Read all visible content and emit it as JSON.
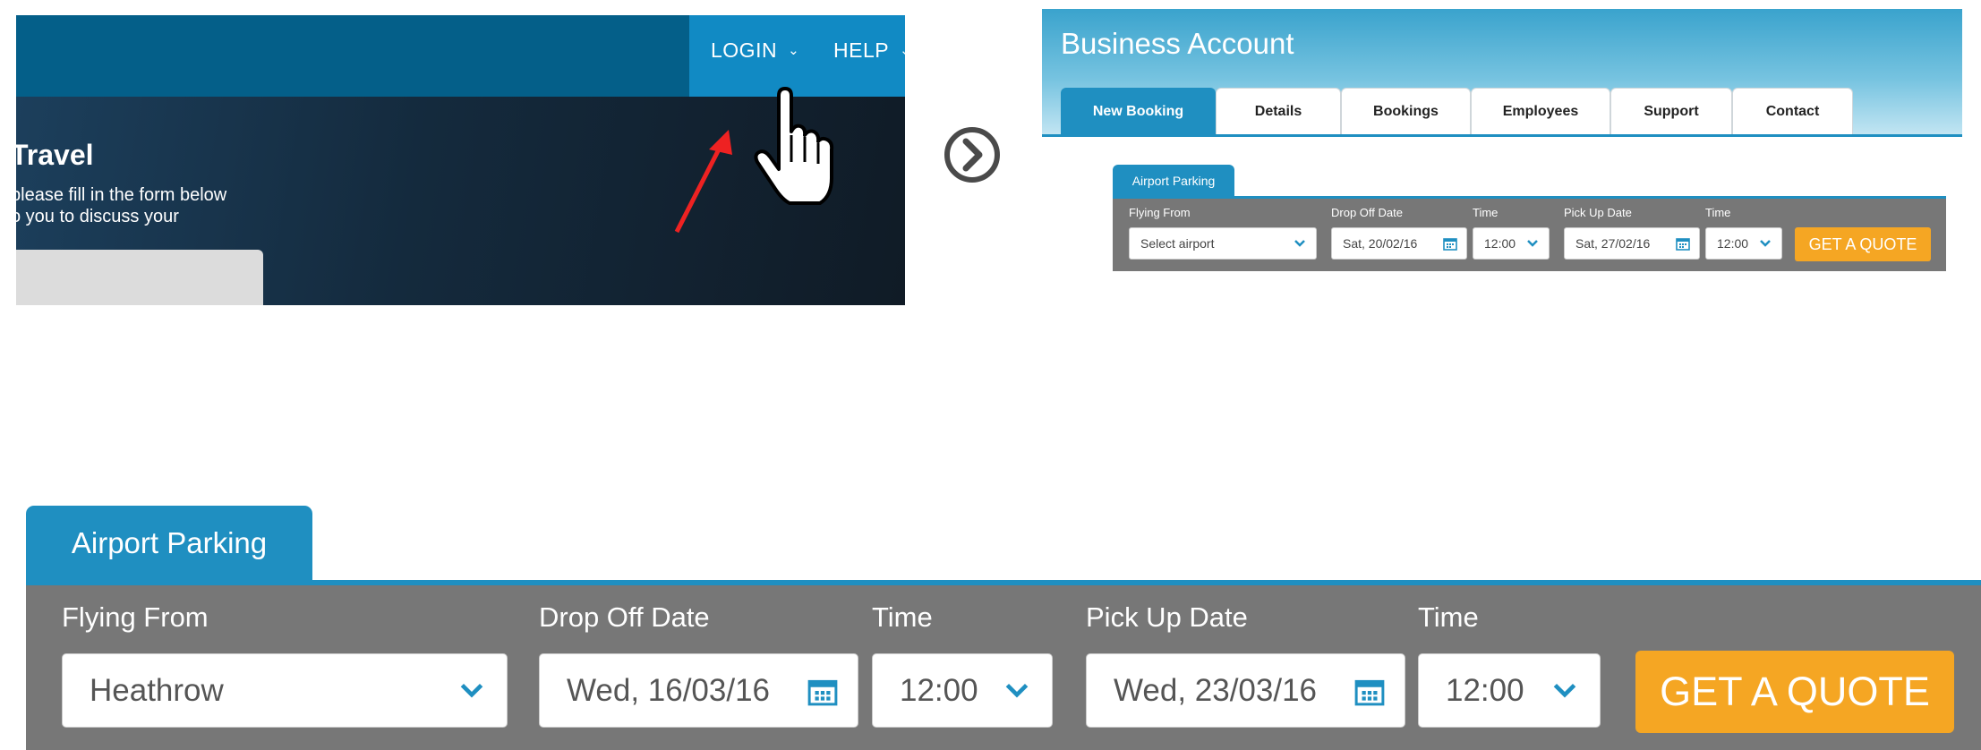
{
  "header_panel": {
    "nav": {
      "login": "LOGIN",
      "help": "HELP"
    },
    "hero": {
      "title": "Travel",
      "line1": "please fill in the form below",
      "line2": "o you to discuss your"
    }
  },
  "business_panel": {
    "title": "Business Account",
    "tabs": [
      "New Booking",
      "Details",
      "Bookings",
      "Employees",
      "Support",
      "Contact"
    ],
    "active_tab": "New Booking",
    "form": {
      "tab_label": "Airport Parking",
      "flying_from_label": "Flying From",
      "flying_from_value": "Select airport",
      "drop_off_label": "Drop Off Date",
      "drop_off_value": "Sat, 20/02/16",
      "time1_label": "Time",
      "time1_value": "12:00",
      "pick_up_label": "Pick Up Date",
      "pick_up_value": "Sat, 27/02/16",
      "time2_label": "Time",
      "time2_value": "12:00",
      "quote_button": "GET A QUOTE"
    }
  },
  "zoom_panel": {
    "form": {
      "tab_label": "Airport Parking",
      "flying_from_label": "Flying From",
      "flying_from_value": "Heathrow",
      "drop_off_label": "Drop Off Date",
      "drop_off_value": "Wed, 16/03/16",
      "time1_label": "Time",
      "time1_value": "12:00",
      "pick_up_label": "Pick Up Date",
      "pick_up_value": "Wed, 23/03/16",
      "time2_label": "Time",
      "time2_value": "12:00",
      "quote_button": "GET A QUOTE"
    }
  },
  "colors": {
    "brand_blue": "#1f8fc1",
    "nav_dark": "#045f89",
    "form_gray": "#777777",
    "quote_orange": "#f5a623",
    "annotation_red": "#ee2222"
  },
  "icons": [
    "chevron-down-icon",
    "calendar-icon",
    "hand-cursor-icon",
    "red-arrow-icon",
    "next-arrow-circle-icon"
  ]
}
